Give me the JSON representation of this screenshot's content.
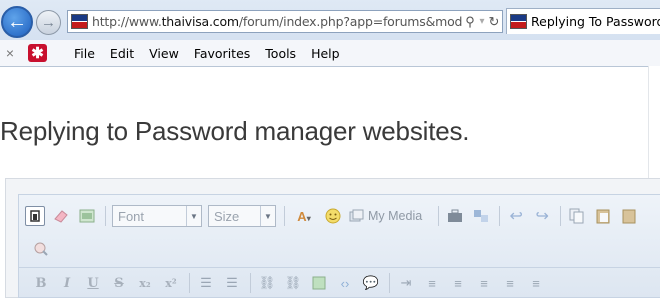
{
  "browser": {
    "url_prefix": "http://www.",
    "url_domain": "thaivisa.com",
    "url_rest": "/forum/index.php?app=forums&module=",
    "favicon_text": "THAI VISA",
    "tab_title": "Replying To Password m",
    "back_glyph": "←",
    "forward_glyph": "→",
    "search_glyph": "⚲",
    "refresh_glyph": "↻"
  },
  "menu": {
    "close_glyph": "×",
    "extension_glyph": "✱",
    "items": [
      "File",
      "Edit",
      "View",
      "Favorites",
      "Tools",
      "Help"
    ]
  },
  "page": {
    "title": "Replying to Password manager websites."
  },
  "editor": {
    "font_placeholder": "Font",
    "size_placeholder": "Size",
    "my_media_label": "My Media",
    "format_row": [
      "B",
      "I",
      "U",
      "S",
      "x₂",
      "x²"
    ]
  },
  "colors": {
    "toolbar_bg": "#dde6f1",
    "title_text": "#3a3a3a",
    "back_button": "#1d5fbf"
  }
}
